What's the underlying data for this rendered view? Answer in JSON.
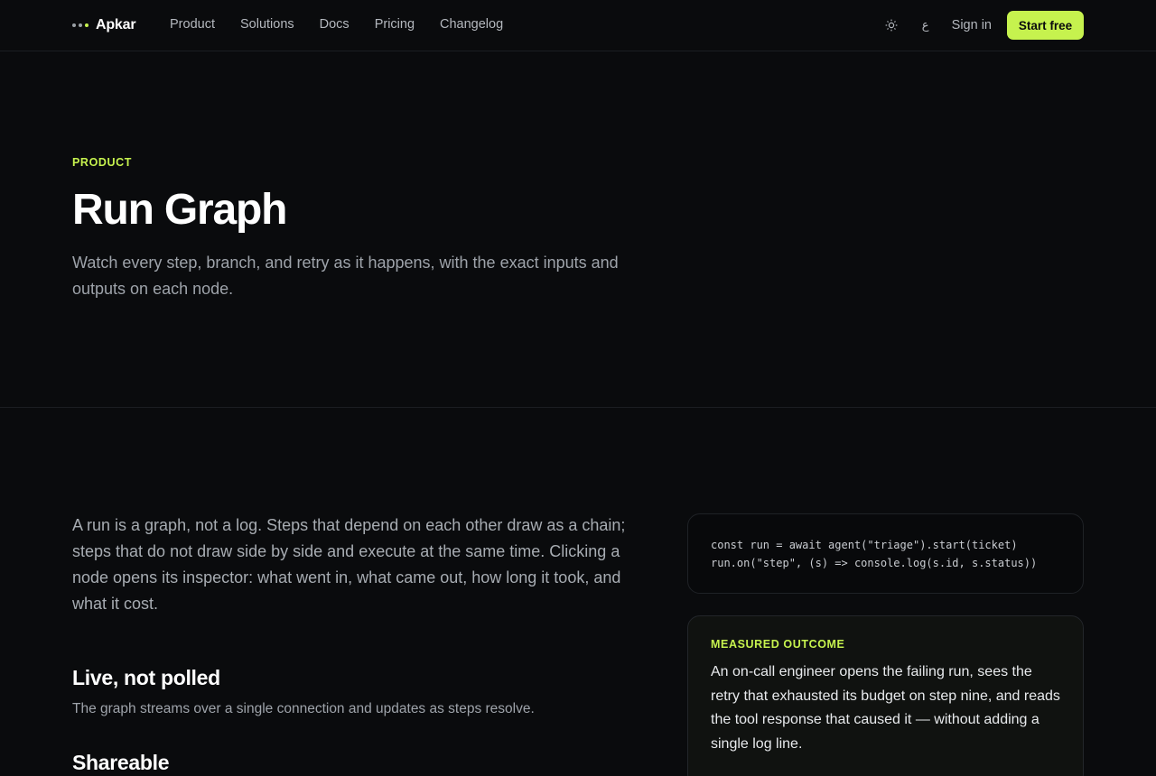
{
  "header": {
    "brand": "Apkar",
    "nav": [
      "Product",
      "Solutions",
      "Docs",
      "Pricing",
      "Changelog"
    ],
    "theme_icon": "sun-icon",
    "lang_glyph": "ع",
    "sign_in": "Sign in",
    "cta": "Start free"
  },
  "hero": {
    "eyebrow": "PRODUCT",
    "title": "Run Graph",
    "subtitle": "Watch every step, branch, and retry as it happens, with the exact inputs and outputs on each node."
  },
  "body": {
    "lead": "A run is a graph, not a log. Steps that depend on each other draw as a chain; steps that do not draw side by side and execute at the same time. Clicking a node opens its inspector: what went in, what came out, how long it took, and what it cost.",
    "features": [
      {
        "title": "Live, not polled",
        "desc": "The graph streams over a single connection and updates as steps resolve."
      },
      {
        "title": "Shareable",
        "desc": ""
      }
    ]
  },
  "code": {
    "lines": [
      "const run = await agent(\"triage\").start(ticket)",
      "run.on(\"step\", (s) => console.log(s.id, s.status))"
    ]
  },
  "outcome": {
    "eyebrow": "MEASURED OUTCOME",
    "text": "An on-call engineer opens the failing run, sees the retry that exhausted its budget on step nine, and reads the tool response that caused it — without adding a single log line."
  },
  "colors": {
    "background": "#0a0b0d",
    "accent": "#c6f24e",
    "muted_text": "#9ea3aa"
  }
}
